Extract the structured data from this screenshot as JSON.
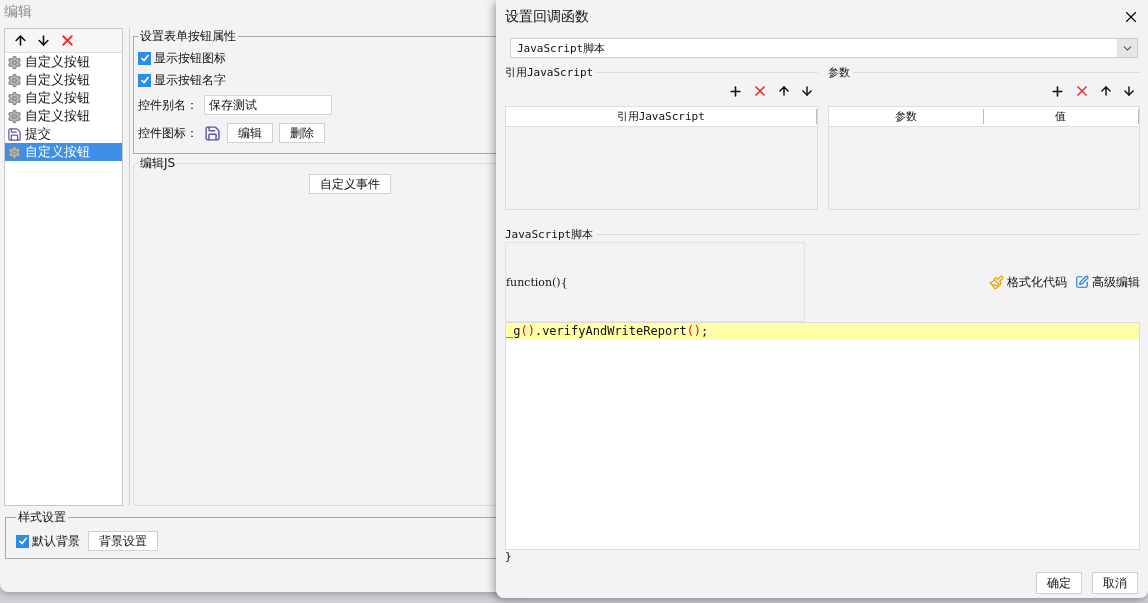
{
  "editor_window": {
    "title": "编辑",
    "items": [
      {
        "label": "自定义按钮",
        "kind": "gear",
        "selected": false
      },
      {
        "label": "自定义按钮",
        "kind": "gear",
        "selected": false
      },
      {
        "label": "自定义按钮",
        "kind": "gear",
        "selected": false
      },
      {
        "label": "自定义按钮",
        "kind": "gear",
        "selected": false
      },
      {
        "label": "提交",
        "kind": "save",
        "selected": false
      },
      {
        "label": "自定义按钮",
        "kind": "gear",
        "selected": true
      }
    ],
    "properties": {
      "legend": "设置表单按钮属性",
      "options": [
        {
          "label": "显示按钮图标",
          "checked": true
        },
        {
          "label": "显示按钮名字",
          "checked": true
        }
      ],
      "alias_label": "控件别名：",
      "alias_value": "保存测试",
      "icon_label": "控件图标：",
      "buttons": [
        "编辑",
        "删除"
      ]
    },
    "js": {
      "legend": "编辑JS",
      "button": "自定义事件"
    },
    "style": {
      "legend": "样式设置",
      "default_background": {
        "label": "默认背景",
        "checked": true
      },
      "button": "背景设置"
    }
  },
  "dialog": {
    "title": "设置回调函数",
    "type_select": "JavaScript脚本",
    "reference": {
      "legend": "引用JavaScript",
      "columns": [
        "引用JavaScript"
      ]
    },
    "parameters": {
      "legend": "参数",
      "columns": [
        "参数",
        "值"
      ]
    },
    "script": {
      "legend": "JavaScript脚本",
      "header": "function(){",
      "tools": [
        {
          "label": "格式化代码",
          "kind": "format"
        },
        {
          "label": "高级编辑",
          "kind": "edit"
        }
      ],
      "lines": [
        [
          {
            "text": "_g",
            "kind": "plain"
          },
          {
            "text": "()",
            "kind": "paren"
          },
          {
            "text": ".verifyAndWriteReport",
            "kind": "plain"
          },
          {
            "text": "()",
            "kind": "paren"
          },
          {
            "text": ";",
            "kind": "plain"
          }
        ]
      ],
      "footer": "}"
    },
    "buttons": [
      "确定",
      "取消"
    ]
  }
}
